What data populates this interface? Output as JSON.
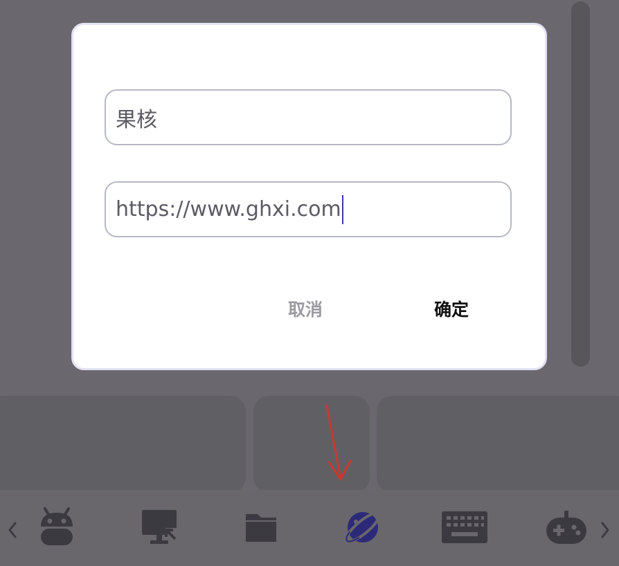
{
  "dialog": {
    "name_value": "果核",
    "url_value": "https://www.ghxi.com",
    "cancel_label": "取消",
    "confirm_label": "确定"
  },
  "bottom_bar": {
    "tools": [
      {
        "icon": "android-icon",
        "active": false
      },
      {
        "icon": "remote-desktop-icon",
        "active": false
      },
      {
        "icon": "folder-icon",
        "active": false
      },
      {
        "icon": "planet-browser-icon",
        "active": true
      },
      {
        "icon": "keyboard-icon",
        "active": false
      },
      {
        "icon": "gamepad-icon",
        "active": false
      }
    ],
    "prev_arrow": "‹",
    "next_arrow": "›"
  },
  "colors": {
    "overlay": "#6a686e",
    "icon_inactive": "#3b3a40",
    "icon_active": "#2c2a78",
    "annotation_arrow": "#c7392f",
    "caret": "#3a3aa8"
  }
}
